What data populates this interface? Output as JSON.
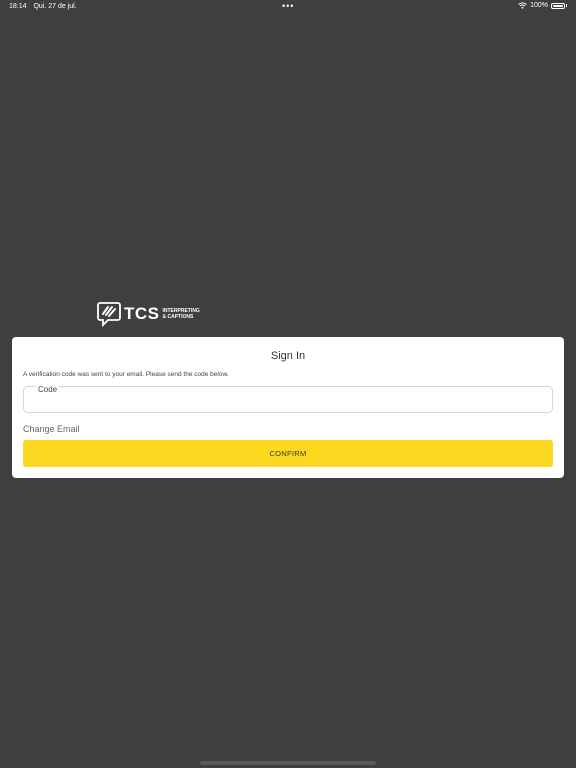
{
  "status_bar": {
    "time": "18:14",
    "date": "Qui. 27 de jul.",
    "dots": "•••",
    "battery": "100%",
    "wifi_icon": "wifi-icon",
    "battery_icon": "battery-icon"
  },
  "logo": {
    "brand": "TCS",
    "line1": "INTERPRETING",
    "line2": "& CAPTIONS"
  },
  "signin": {
    "title": "Sign In",
    "message": "A verification code was sent to your email. Please send the code below.",
    "code_label": "Code",
    "code_value": "",
    "change_email": "Change Email",
    "confirm_label": "CONFIRM"
  },
  "colors": {
    "background": "#403e41",
    "card": "#ffffff",
    "accent": "#fcd920"
  }
}
